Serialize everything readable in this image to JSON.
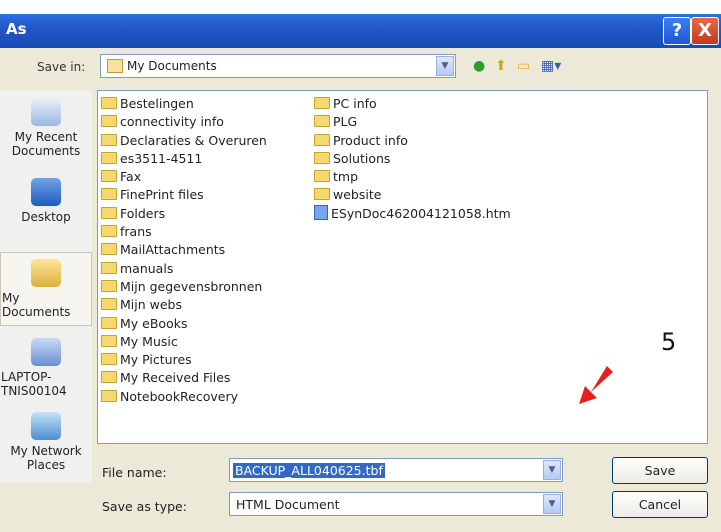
{
  "window": {
    "title": "As",
    "help_glyph": "?",
    "close_glyph": "X"
  },
  "save_in": {
    "label": "Save in:",
    "value": "My Documents"
  },
  "sidebar": {
    "places": [
      {
        "label_line1": "My Recent",
        "label_line2": "Documents",
        "icon": "recent-documents-icon"
      },
      {
        "label_line1": "Desktop",
        "label_line2": "",
        "icon": "desktop-icon"
      },
      {
        "label_line1": "My Documents",
        "label_line2": "",
        "icon": "my-documents-icon"
      },
      {
        "label_line1": "LAPTOP-TNIS00104",
        "label_line2": "",
        "icon": "my-computer-icon"
      },
      {
        "label_line1": "My Network",
        "label_line2": "Places",
        "icon": "network-places-icon"
      }
    ]
  },
  "files": {
    "column1": [
      "Bestelingen",
      "connectivity info",
      "Declaraties & Overuren",
      "es3511-4511",
      "Fax",
      "FinePrint files",
      "Folders",
      "frans",
      "MailAttachments",
      "manuals",
      "Mijn gegevensbronnen",
      "Mijn webs",
      "My eBooks",
      "My Music",
      "My Pictures",
      "My Received Files",
      "NotebookRecovery"
    ],
    "column2": [
      "PC info",
      "PLG",
      "Product info",
      "Solutions",
      "tmp",
      "website"
    ],
    "column2_file": "ESynDoc462004121058.htm"
  },
  "filename": {
    "label": "File name:",
    "value": "BACKUP_ALL040625.tbf"
  },
  "savetype": {
    "label": "Save as type:",
    "value": "HTML Document"
  },
  "buttons": {
    "save": "Save",
    "cancel": "Cancel"
  },
  "annotation": {
    "step_number": "5",
    "arrow_color": "#e8201c"
  }
}
